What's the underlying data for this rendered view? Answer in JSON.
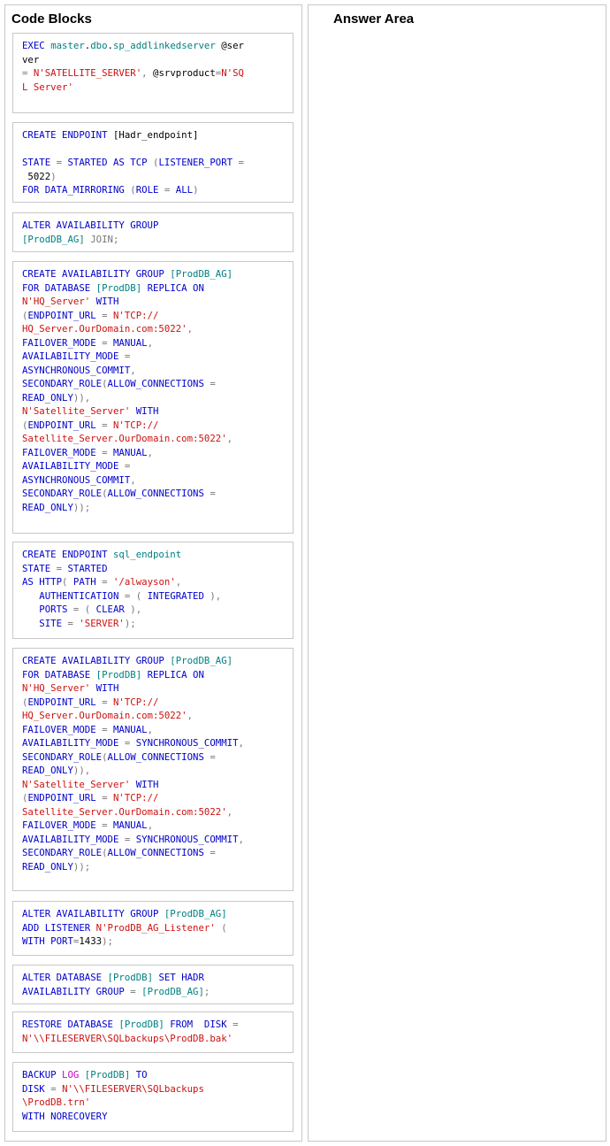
{
  "code_blocks_title": "Code Blocks",
  "answer_area_title": "Answer Area",
  "colors": {
    "keyword": "#0000cc",
    "string": "#cc1111",
    "object": "#008080",
    "operator": "#777777",
    "function": "#cc00cc",
    "border": "#c8c8c8"
  },
  "blocks": [
    {
      "name": "add-linked-server",
      "lines": [
        [
          [
            "kw",
            "EXEC "
          ],
          [
            "obj",
            "master"
          ],
          [
            "txt",
            "."
          ],
          [
            "obj",
            "dbo"
          ],
          [
            "txt",
            "."
          ],
          [
            "obj",
            "sp_addlinkedserver"
          ],
          [
            "txt",
            " @ser"
          ]
        ],
        [
          [
            "txt",
            "ver"
          ]
        ],
        [
          [
            "op",
            "= "
          ],
          [
            "str",
            "N'SATELLITE_SERVER'"
          ],
          [
            "op",
            ", "
          ],
          [
            "txt",
            "@srvproduct"
          ],
          [
            "op",
            "="
          ],
          [
            "str",
            "N'SQ"
          ]
        ],
        [
          [
            "str",
            "L Server'"
          ]
        ]
      ]
    },
    {
      "name": "create-hadr-endpoint",
      "lines": [
        [
          [
            "kw",
            "CREATE ENDPOINT "
          ],
          [
            "txt",
            "[Hadr_endpoint]"
          ]
        ],
        [
          [
            "txt",
            ""
          ]
        ],
        [
          [
            "kw",
            "STATE "
          ],
          [
            "op",
            "= "
          ],
          [
            "kw",
            "STARTED AS TCP "
          ],
          [
            "op",
            "("
          ],
          [
            "kw",
            "LISTENER_PORT "
          ],
          [
            "op",
            "="
          ]
        ],
        [
          [
            "txt",
            " 5022"
          ],
          [
            "op",
            ")"
          ]
        ],
        [
          [
            "kw",
            "FOR DATA_MIRRORING "
          ],
          [
            "op",
            "("
          ],
          [
            "kw",
            "ROLE "
          ],
          [
            "op",
            "= "
          ],
          [
            "kw",
            "ALL"
          ],
          [
            "op",
            ")"
          ]
        ]
      ]
    },
    {
      "name": "alter-ag-join",
      "lines": [
        [
          [
            "kw",
            "ALTER AVAILABILITY GROUP"
          ]
        ],
        [
          [
            "obj",
            "[ProdDB_AG]"
          ],
          [
            "op",
            " JOIN;"
          ]
        ]
      ]
    },
    {
      "name": "create-ag-async",
      "lines": [
        [
          [
            "kw",
            "CREATE AVAILABILITY GROUP "
          ],
          [
            "obj",
            "[ProdDB_AG]"
          ]
        ],
        [
          [
            "kw",
            "FOR DATABASE "
          ],
          [
            "obj",
            "[ProdDB]"
          ],
          [
            "kw",
            " REPLICA ON"
          ]
        ],
        [
          [
            "str",
            "N'HQ_Server'"
          ],
          [
            "kw",
            " WITH"
          ]
        ],
        [
          [
            "op",
            "("
          ],
          [
            "kw",
            "ENDPOINT_URL "
          ],
          [
            "op",
            "= "
          ],
          [
            "str",
            "N'TCP://"
          ]
        ],
        [
          [
            "str",
            "HQ_Server.OurDomain.com:5022'"
          ],
          [
            "op",
            ","
          ]
        ],
        [
          [
            "kw",
            "FAILOVER_MODE "
          ],
          [
            "op",
            "= "
          ],
          [
            "kw",
            "MANUAL"
          ],
          [
            "op",
            ","
          ]
        ],
        [
          [
            "kw",
            "AVAILABILITY_MODE "
          ],
          [
            "op",
            "="
          ]
        ],
        [
          [
            "kw",
            "ASYNCHRONOUS_COMMIT"
          ],
          [
            "op",
            ","
          ]
        ],
        [
          [
            "kw",
            "SECONDARY_ROLE"
          ],
          [
            "op",
            "("
          ],
          [
            "kw",
            "ALLOW_CONNECTIONS "
          ],
          [
            "op",
            "="
          ]
        ],
        [
          [
            "kw",
            "READ_ONLY"
          ],
          [
            "op",
            "))"
          ],
          [
            "op",
            ","
          ]
        ],
        [
          [
            "str",
            "N'Satellite_Server'"
          ],
          [
            "kw",
            " WITH"
          ]
        ],
        [
          [
            "op",
            "("
          ],
          [
            "kw",
            "ENDPOINT_URL "
          ],
          [
            "op",
            "= "
          ],
          [
            "str",
            "N'TCP://"
          ]
        ],
        [
          [
            "str",
            "Satellite_Server.OurDomain.com:5022'"
          ],
          [
            "op",
            ","
          ]
        ],
        [
          [
            "kw",
            "FAILOVER_MODE "
          ],
          [
            "op",
            "= "
          ],
          [
            "kw",
            "MANUAL"
          ],
          [
            "op",
            ","
          ]
        ],
        [
          [
            "kw",
            "AVAILABILITY_MODE "
          ],
          [
            "op",
            "="
          ]
        ],
        [
          [
            "kw",
            "ASYNCHRONOUS_COMMIT"
          ],
          [
            "op",
            ","
          ]
        ],
        [
          [
            "kw",
            "SECONDARY_ROLE"
          ],
          [
            "op",
            "("
          ],
          [
            "kw",
            "ALLOW_CONNECTIONS "
          ],
          [
            "op",
            "="
          ]
        ],
        [
          [
            "kw",
            "READ_ONLY"
          ],
          [
            "op",
            "));"
          ]
        ]
      ]
    },
    {
      "name": "create-sql-endpoint",
      "lines": [
        [
          [
            "kw",
            "CREATE ENDPOINT "
          ],
          [
            "obj",
            "sql_endpoint"
          ]
        ],
        [
          [
            "kw",
            "STATE "
          ],
          [
            "op",
            "= "
          ],
          [
            "kw",
            "STARTED"
          ]
        ],
        [
          [
            "kw",
            "AS HTTP"
          ],
          [
            "op",
            "( "
          ],
          [
            "kw",
            "PATH "
          ],
          [
            "op",
            "= "
          ],
          [
            "str",
            "'/alwayson'"
          ],
          [
            "op",
            ","
          ]
        ],
        [
          [
            "kw",
            "   AUTHENTICATION "
          ],
          [
            "op",
            "= ( "
          ],
          [
            "kw",
            "INTEGRATED "
          ],
          [
            "op",
            "),"
          ]
        ],
        [
          [
            "kw",
            "   PORTS "
          ],
          [
            "op",
            "= ( "
          ],
          [
            "kw",
            "CLEAR "
          ],
          [
            "op",
            "),"
          ]
        ],
        [
          [
            "kw",
            "   SITE "
          ],
          [
            "op",
            "= "
          ],
          [
            "str",
            "'SERVER'"
          ],
          [
            "op",
            ");"
          ]
        ]
      ]
    },
    {
      "name": "create-ag-sync",
      "lines": [
        [
          [
            "kw",
            "CREATE AVAILABILITY GROUP "
          ],
          [
            "obj",
            "[ProdDB_AG]"
          ]
        ],
        [
          [
            "kw",
            "FOR DATABASE "
          ],
          [
            "obj",
            "[ProdDB]"
          ],
          [
            "kw",
            " REPLICA ON"
          ]
        ],
        [
          [
            "str",
            "N'HQ_Server'"
          ],
          [
            "kw",
            " WITH"
          ]
        ],
        [
          [
            "op",
            "("
          ],
          [
            "kw",
            "ENDPOINT_URL "
          ],
          [
            "op",
            "= "
          ],
          [
            "str",
            "N'TCP://"
          ]
        ],
        [
          [
            "str",
            "HQ_Server.OurDomain.com:5022'"
          ],
          [
            "op",
            ","
          ]
        ],
        [
          [
            "kw",
            "FAILOVER_MODE "
          ],
          [
            "op",
            "= "
          ],
          [
            "kw",
            "MANUAL"
          ],
          [
            "op",
            ","
          ]
        ],
        [
          [
            "kw",
            "AVAILABILITY_MODE "
          ],
          [
            "op",
            "= "
          ],
          [
            "kw",
            "SYNCHRONOUS_COMMIT"
          ],
          [
            "op",
            ","
          ]
        ],
        [
          [
            "kw",
            "SECONDARY_ROLE"
          ],
          [
            "op",
            "("
          ],
          [
            "kw",
            "ALLOW_CONNECTIONS "
          ],
          [
            "op",
            "="
          ]
        ],
        [
          [
            "kw",
            "READ_ONLY"
          ],
          [
            "op",
            "))"
          ],
          [
            "op",
            ","
          ]
        ],
        [
          [
            "str",
            "N'Satellite_Server'"
          ],
          [
            "kw",
            " WITH"
          ]
        ],
        [
          [
            "op",
            "("
          ],
          [
            "kw",
            "ENDPOINT_URL "
          ],
          [
            "op",
            "= "
          ],
          [
            "str",
            "N'TCP://"
          ]
        ],
        [
          [
            "str",
            "Satellite_Server.OurDomain.com:5022'"
          ],
          [
            "op",
            ","
          ]
        ],
        [
          [
            "kw",
            "FAILOVER_MODE "
          ],
          [
            "op",
            "= "
          ],
          [
            "kw",
            "MANUAL"
          ],
          [
            "op",
            ","
          ]
        ],
        [
          [
            "kw",
            "AVAILABILITY_MODE "
          ],
          [
            "op",
            "= "
          ],
          [
            "kw",
            "SYNCHRONOUS_COMMIT"
          ],
          [
            "op",
            ","
          ]
        ],
        [
          [
            "kw",
            "SECONDARY_ROLE"
          ],
          [
            "op",
            "("
          ],
          [
            "kw",
            "ALLOW_CONNECTIONS "
          ],
          [
            "op",
            "="
          ]
        ],
        [
          [
            "kw",
            "READ_ONLY"
          ],
          [
            "op",
            "));"
          ]
        ]
      ]
    },
    {
      "name": "add-listener",
      "lines": [
        [
          [
            "kw",
            "ALTER AVAILABILITY GROUP "
          ],
          [
            "obj",
            "[ProdDB_AG]"
          ]
        ],
        [
          [
            "kw",
            "ADD LISTENER "
          ],
          [
            "str",
            "N'ProdDB_AG_Listener'"
          ],
          [
            "op",
            " ("
          ]
        ],
        [
          [
            "kw",
            "WITH PORT"
          ],
          [
            "op",
            "="
          ],
          [
            "txt",
            "1433"
          ],
          [
            "op",
            ");"
          ]
        ]
      ]
    },
    {
      "name": "alter-database-set-hadr",
      "lines": [
        [
          [
            "kw",
            "ALTER DATABASE "
          ],
          [
            "obj",
            "[ProdDB]"
          ],
          [
            "kw",
            " SET HADR"
          ]
        ],
        [
          [
            "kw",
            "AVAILABILITY GROUP "
          ],
          [
            "op",
            "= "
          ],
          [
            "obj",
            "[ProdDB_AG]"
          ],
          [
            "op",
            ";"
          ]
        ]
      ]
    },
    {
      "name": "restore-database",
      "lines": [
        [
          [
            "kw",
            "RESTORE DATABASE "
          ],
          [
            "obj",
            "[ProdDB]"
          ],
          [
            "kw",
            " FROM  DISK "
          ],
          [
            "op",
            "="
          ]
        ],
        [
          [
            "str",
            "N'\\\\FILESERVER\\SQLbackups\\ProdDB.bak'"
          ]
        ]
      ]
    },
    {
      "name": "backup-log",
      "lines": [
        [
          [
            "kw",
            "BACKUP "
          ],
          [
            "fn",
            "LOG "
          ],
          [
            "obj",
            "[ProdDB]"
          ],
          [
            "kw",
            " TO"
          ]
        ],
        [
          [
            "kw",
            "DISK "
          ],
          [
            "op",
            "= "
          ],
          [
            "str",
            "N'\\\\FILESERVER\\SQLbackups"
          ]
        ],
        [
          [
            "str",
            "\\ProdDB.trn'"
          ]
        ],
        [
          [
            "kw",
            "WITH NORECOVERY"
          ]
        ]
      ]
    }
  ]
}
